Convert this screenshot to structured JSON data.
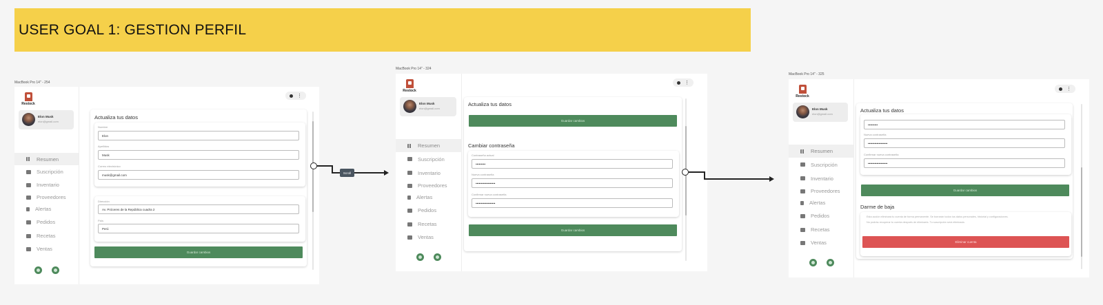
{
  "banner": {
    "title": "USER GOAL 1: GESTION PERFIL"
  },
  "frames": [
    {
      "label": "MacBook Pro 14\" - 254"
    },
    {
      "label": "MacBook Pro 14\" - 324"
    },
    {
      "label": "MacBook Pro 14\" - 325"
    }
  ],
  "app": {
    "logo_text": "Restock",
    "user": {
      "name": "Elon Musk",
      "email": "elon@gmail.com"
    },
    "nav": [
      "Resumen",
      "Suscripción",
      "Inventario",
      "Proveedores",
      "Alertas",
      "Pedidos",
      "Recetas",
      "Ventas"
    ]
  },
  "screen1": {
    "title": "Actualiza tus datos",
    "fields": [
      {
        "label": "Nombre",
        "value": "Elon"
      },
      {
        "label": "Apellidos",
        "value": "Musk"
      },
      {
        "label": "Correo electrónico",
        "value": "musk@gmail.com"
      },
      {
        "label": "Dirección",
        "value": "Av. Próceres de la República cuadra 2"
      },
      {
        "label": "País",
        "value": "Perú"
      }
    ],
    "save": "Guardar cambios"
  },
  "screen2": {
    "title": "Actualiza tus datos",
    "save_top": "Guardar cambios",
    "password_title": "Cambiar contraseña",
    "fields": [
      {
        "label": "Contraseña actual",
        "value": "•••••••••"
      },
      {
        "label": "Nueva contraseña",
        "value": "••••••••••••••••••"
      },
      {
        "label": "Confirmar nueva contraseña",
        "value": "••••••••••••••••••"
      }
    ],
    "save": "Guardar cambios"
  },
  "screen3": {
    "title": "Actualiza tus datos",
    "fields": [
      {
        "label": "",
        "value": "•••••••••"
      },
      {
        "label": "Nueva contraseña",
        "value": "••••••••••••••••••"
      },
      {
        "label": "Confirmar nueva contraseña",
        "value": "••••••••••••••••••"
      }
    ],
    "save": "Guardar cambios",
    "delete_title": "Darme de baja",
    "delete_note_1": "Esta acción eliminará tu cuenta de forma permanente. Se borrarán todos tus datos personales, historial y configuraciones.",
    "delete_note_2": "No podrás recuperar tu cuenta después de eliminarla. Tu suscripción será eliminada.",
    "delete_button": "Eliminar cuenta"
  },
  "flow": {
    "scroll_tag": "Scroll"
  },
  "colors": {
    "banner": "#f5d04a",
    "primary": "#4e8a5c",
    "danger": "#dd5454"
  }
}
